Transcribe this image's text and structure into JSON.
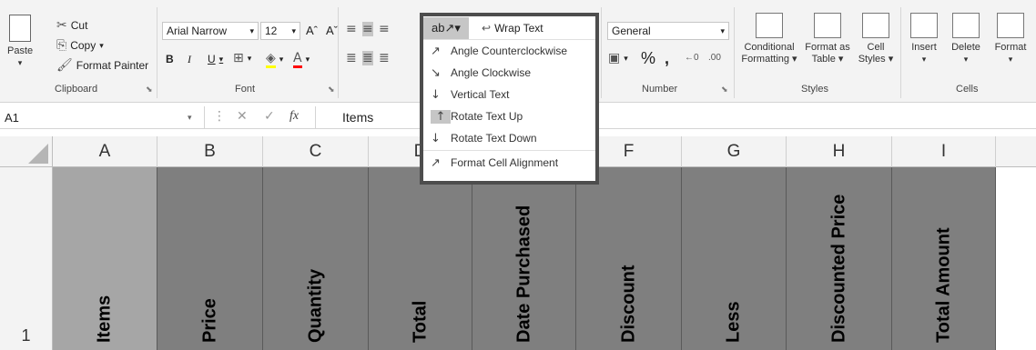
{
  "clipboard": {
    "paste": "Paste",
    "cut": "Cut",
    "copy": "Copy",
    "format_painter": "Format Painter",
    "group": "Clipboard"
  },
  "font": {
    "name": "Arial Narrow",
    "size": "12",
    "bold": "B",
    "italic": "I",
    "underline": "U",
    "grow": "Aˆ",
    "shrink": "Aˇ",
    "group": "Font"
  },
  "alignment": {
    "wrap_text": "Wrap Text"
  },
  "number": {
    "format": "General",
    "currency": "€",
    "percent": "%",
    "comma": ")",
    "group": "Number"
  },
  "styles": {
    "conditional": "Conditional",
    "conditional2": "Formatting ▾",
    "format_as": "Format as",
    "format_as2": "Table ▾",
    "cell": "Cell",
    "cell2": "Styles ▾",
    "group": "Styles"
  },
  "cells": {
    "insert": "Insert",
    "delete": "Delete",
    "format": "Format",
    "group": "Cells"
  },
  "formula_bar": {
    "name_box": "A1",
    "fx": "fx",
    "content": "Items"
  },
  "columns": [
    "A",
    "B",
    "C",
    "D",
    "E",
    "F",
    "G",
    "H",
    "I"
  ],
  "row_number": "1",
  "cells_row1": [
    "Items",
    "Price",
    "Quantity",
    "Total",
    "Date Purchased",
    "Discount",
    "Less",
    "Discounted Price",
    "Total Amount"
  ],
  "orientation_menu": {
    "items": [
      "Angle Counterclockwise",
      "Angle Clockwise",
      "Vertical Text",
      "Rotate Text Up",
      "Rotate Text Down",
      "Format Cell Alignment"
    ]
  },
  "colors": {
    "header_fill": "#7f7f7f",
    "selected_fill": "#a6a6a6",
    "ribbon": "#f3f3f3"
  }
}
